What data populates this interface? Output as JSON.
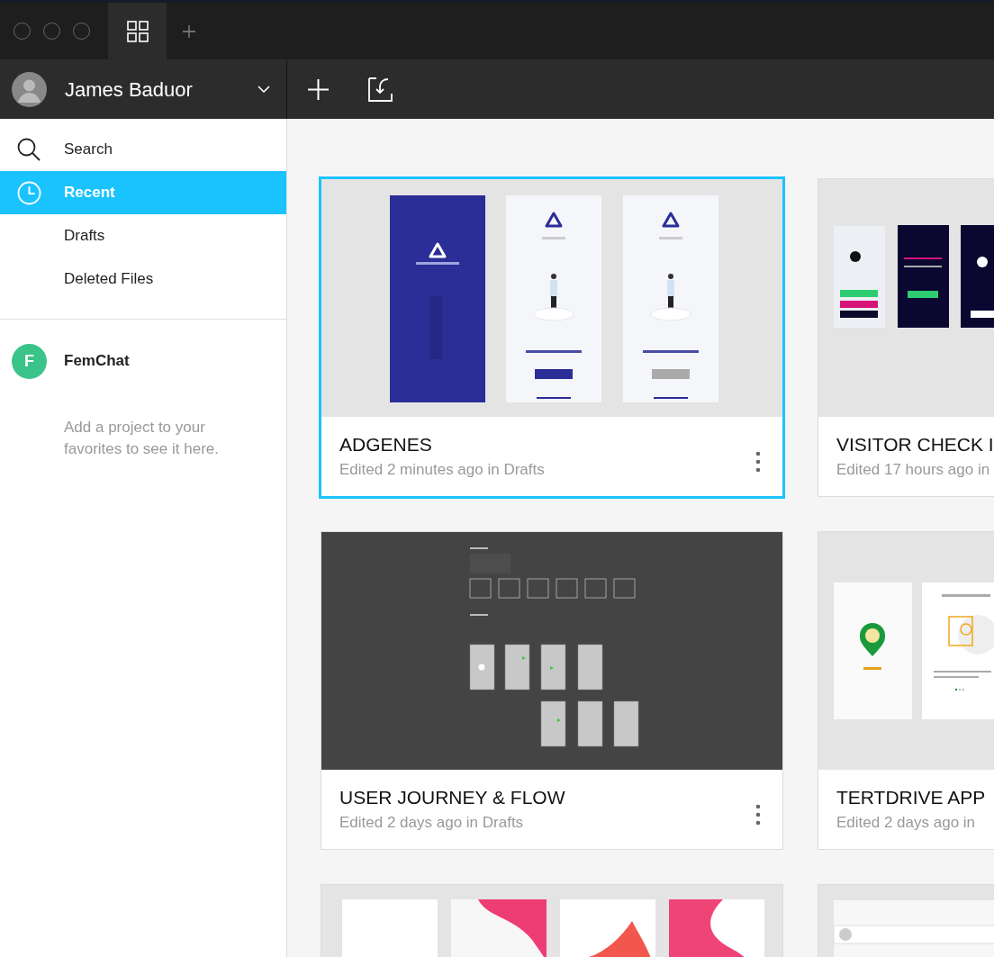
{
  "user": {
    "name": "James Baduor"
  },
  "sidebar": {
    "items": [
      {
        "label": "Search",
        "selected": false
      },
      {
        "label": "Recent",
        "selected": true
      },
      {
        "label": "Drafts",
        "selected": false
      },
      {
        "label": "Deleted Files",
        "selected": false
      }
    ],
    "favorites": [
      {
        "initial": "F",
        "name": "FemChat"
      }
    ],
    "favorites_hint": "Add a project to your favorites to see it here."
  },
  "files": [
    {
      "title": "ADGENES",
      "subtitle": "Edited 2 minutes ago in Drafts",
      "selected": true,
      "menu": true
    },
    {
      "title": "VISITOR CHECK I",
      "subtitle": "Edited 17 hours ago in",
      "selected": false
    },
    {
      "title": "USER JOURNEY & FLOW",
      "subtitle": "Edited 2 days ago in Drafts",
      "selected": false,
      "menu": true
    },
    {
      "title": "TERTDRIVE APP",
      "subtitle": "Edited 2 days ago in",
      "selected": false
    },
    {
      "selected": false
    },
    {
      "selected": false
    }
  ]
}
